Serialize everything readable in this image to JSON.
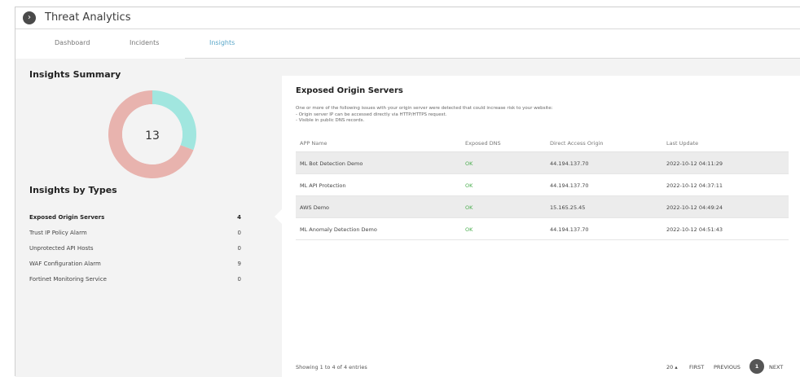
{
  "header": {
    "title": "Threat Analytics",
    "toggle_icon": "chevron-right-icon",
    "toggle_glyph": "›"
  },
  "tabs": [
    {
      "label": "Dashboard"
    },
    {
      "label": "Incidents"
    },
    {
      "label": "Insights",
      "active": true
    }
  ],
  "summary": {
    "title": "Insights Summary",
    "total": "13",
    "chart_data": {
      "type": "pie",
      "values": [
        4,
        9
      ],
      "colors": [
        "#a1e6df",
        "#e8b3ae"
      ]
    }
  },
  "types": {
    "title": "Insights by Types",
    "items": [
      {
        "name": "Exposed Origin Servers",
        "count": "4",
        "selected": true
      },
      {
        "name": "Trust IP Policy Alarm",
        "count": "0"
      },
      {
        "name": "Unprotected API Hosts",
        "count": "0"
      },
      {
        "name": "WAF Configuration Alarm",
        "count": "9"
      },
      {
        "name": "Fortinet Monitoring Service",
        "count": "0"
      }
    ]
  },
  "detail": {
    "title": "Exposed Origin Servers",
    "description": [
      "One or more of the following issues with your origin server were detected that could increase risk to your website:",
      "- Origin server IP can be accessed directly via HTTP/HTTPS request.",
      "- Visible in public DNS records."
    ],
    "columns": [
      "APP Name",
      "Exposed DNS",
      "Direct Access Origin",
      "Last Update"
    ],
    "rows": [
      [
        "ML Bot Detection Demo",
        "OK",
        "44.194.137.70",
        "2022-10-12 04:11:29"
      ],
      [
        "ML API Protection",
        "OK",
        "44.194.137.70",
        "2022-10-12 04:37:11"
      ],
      [
        "AWS Demo",
        "OK",
        "15.165.25.45",
        "2022-10-12 04:49:24"
      ],
      [
        "ML Anomaly Detection Demo",
        "OK",
        "44.194.137.70",
        "2022-10-12 04:51:43"
      ]
    ],
    "footer": "Showing 1 to 4 of 4 entries"
  },
  "pager": {
    "page_size": "20 ▴",
    "first": "FIRST",
    "previous": "PREVIOUS",
    "current": "1",
    "next": "NEXT"
  },
  "colors": {
    "active_tab": "#5aa7c9",
    "ok": "#4caf50",
    "panel_bg": "#f3f3f3"
  }
}
